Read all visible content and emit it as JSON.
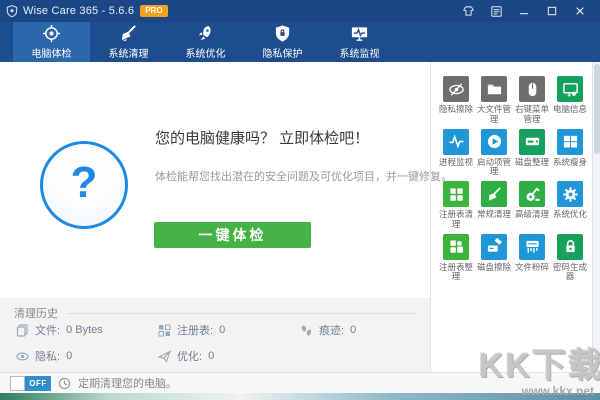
{
  "window": {
    "title": "Wise Care 365 - 5.6.6",
    "badge": "PRO",
    "titlebar_icons": [
      "app-shield-icon",
      "theme-skin-icon",
      "menu-icon",
      "minimize-icon",
      "maximize-icon",
      "close-icon"
    ]
  },
  "colors": {
    "titlebar": "#1b4784",
    "nav": "#1d4d8f",
    "active_tab": "#2c67ac",
    "accent_green_button": "#44b244",
    "circle_blue": "#1e88e5",
    "badge_orange": "#f5a01d",
    "toggle_blue": "#2e8ece"
  },
  "nav": {
    "tabs": [
      {
        "label": "电脑体检",
        "icon": "target-icon",
        "active": true
      },
      {
        "label": "系统清理",
        "icon": "broom-icon",
        "active": false
      },
      {
        "label": "系统优化",
        "icon": "rocket-icon",
        "active": false
      },
      {
        "label": "隐私保护",
        "icon": "shield-lock-icon",
        "active": false
      },
      {
        "label": "系统监视",
        "icon": "monitor-pulse-icon",
        "active": false
      }
    ]
  },
  "main": {
    "question_mark": "?",
    "heading": "您的电脑健康吗？ 立即体检吧！",
    "description": "体检能帮您找出潜在的安全问题及可优化项目，并一键修复。",
    "button_label": "一键体检"
  },
  "tools": {
    "items": [
      {
        "label": "隐私擦除",
        "icon": "privacy-eraser-icon",
        "color": "#6e6e6e"
      },
      {
        "label": "大文件管理",
        "icon": "big-file-manager-icon",
        "color": "#6e6e6e"
      },
      {
        "label": "右键菜单管理",
        "icon": "context-menu-icon",
        "color": "#6e6e6e"
      },
      {
        "label": "电脑信息",
        "icon": "pc-info-icon",
        "color": "#16a05d"
      },
      {
        "label": "进程监视",
        "icon": "process-monitor-icon",
        "color": "#1e96d7"
      },
      {
        "label": "启动项管理",
        "icon": "startup-manager-icon",
        "color": "#1e96d7"
      },
      {
        "label": "磁盘整理",
        "icon": "disk-defrag-icon",
        "color": "#16a05d"
      },
      {
        "label": "系统瘦身",
        "icon": "windows-icon",
        "color": "#1e96d7"
      },
      {
        "label": "注册表清理",
        "icon": "registry-cleaner-icon",
        "color": "#3cb53c"
      },
      {
        "label": "常规清理",
        "icon": "common-cleaner-icon",
        "color": "#2fae46"
      },
      {
        "label": "高级清理",
        "icon": "advanced-cleaner-icon",
        "color": "#2fae46"
      },
      {
        "label": "系统优化",
        "icon": "system-tuneup-icon",
        "color": "#1e96d7"
      },
      {
        "label": "注册表整理",
        "icon": "registry-defrag-icon",
        "color": "#3cb53c"
      },
      {
        "label": "磁盘擦除",
        "icon": "disk-eraser-icon",
        "color": "#1e96d7"
      },
      {
        "label": "文件粉碎",
        "icon": "file-shredder-icon",
        "color": "#1e96d7"
      },
      {
        "label": "密码生成器",
        "icon": "password-generator-icon",
        "color": "#16a05d"
      }
    ]
  },
  "history": {
    "title": "清理历史",
    "stats": [
      {
        "icon": "files-icon",
        "label": "文件:",
        "value": "0 Bytes"
      },
      {
        "icon": "registry-grid-icon",
        "label": "注册表:",
        "value": "0"
      },
      {
        "icon": "footprints-icon",
        "label": "痕迹:",
        "value": "0"
      },
      {
        "icon": "eye-icon",
        "label": "隐私:",
        "value": "0"
      },
      {
        "icon": "paper-plane-icon",
        "label": "优化:",
        "value": "0"
      }
    ]
  },
  "footer": {
    "toggle_label": "OFF",
    "toggle_state": "off",
    "icon": "clock-icon",
    "text": "定期清理您的电脑。"
  },
  "watermark": {
    "text": "KK下载",
    "url": "www.kkx.net"
  }
}
